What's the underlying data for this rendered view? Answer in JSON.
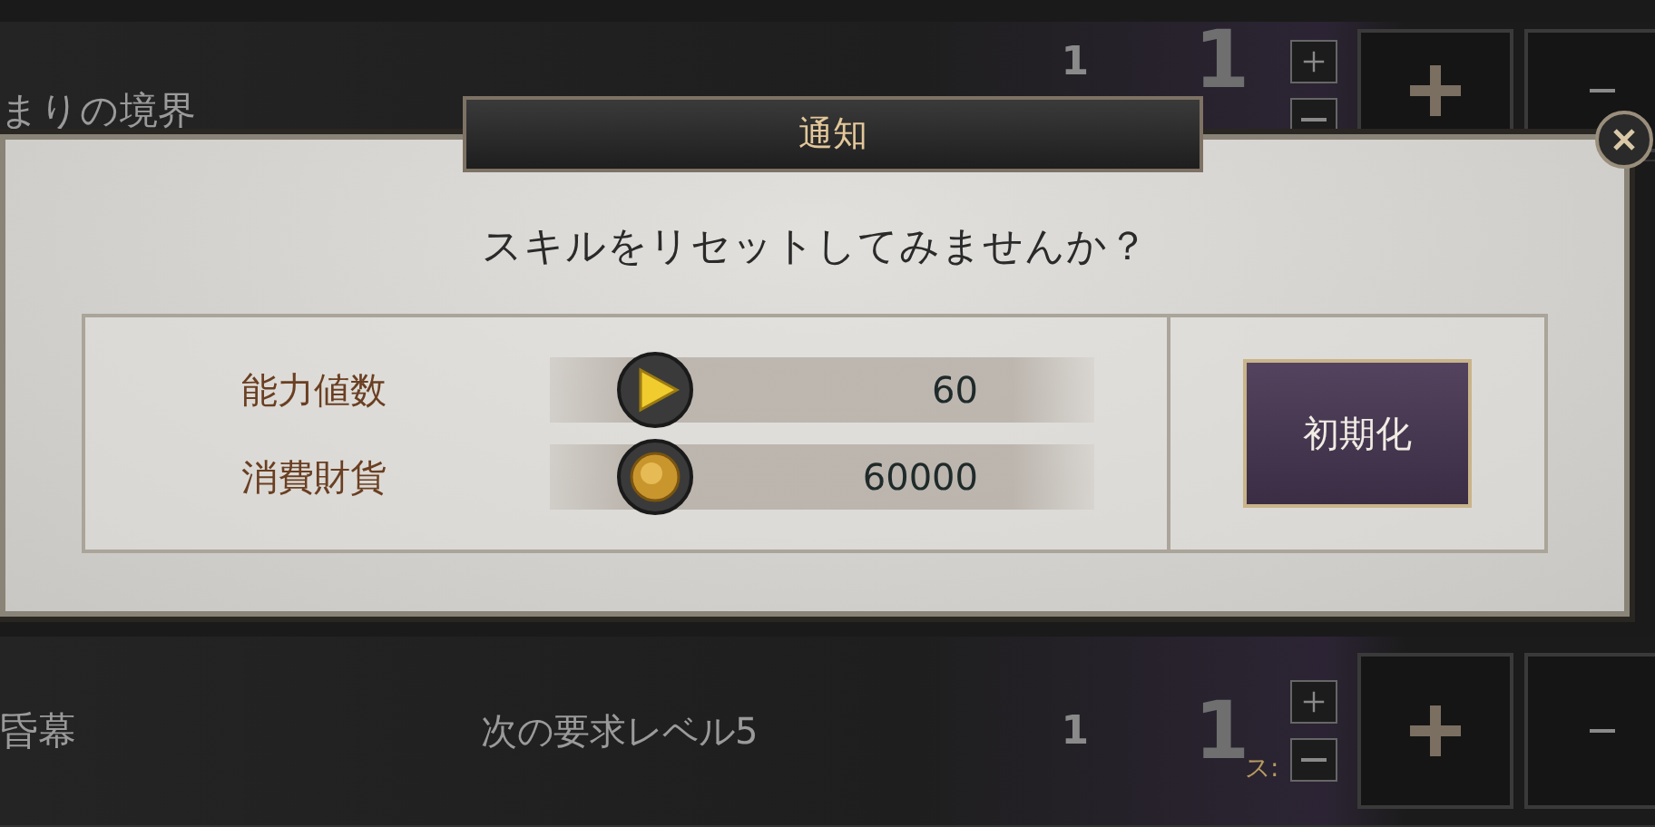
{
  "skill_rows": [
    {
      "name": "まりの境界",
      "value": "1",
      "level": "1"
    },
    {
      "name": "昏幕",
      "requirement": "次の要求レベル5",
      "value": "1",
      "level": "1",
      "note": "ス:"
    }
  ],
  "dialog": {
    "title": "通知",
    "message": "スキルをリセットしてみませんか？",
    "costs": [
      {
        "label": "能力値数",
        "kind": "points",
        "amount": "60"
      },
      {
        "label": "消費財貨",
        "kind": "coin",
        "amount": "60000"
      }
    ],
    "button": "初期化"
  }
}
